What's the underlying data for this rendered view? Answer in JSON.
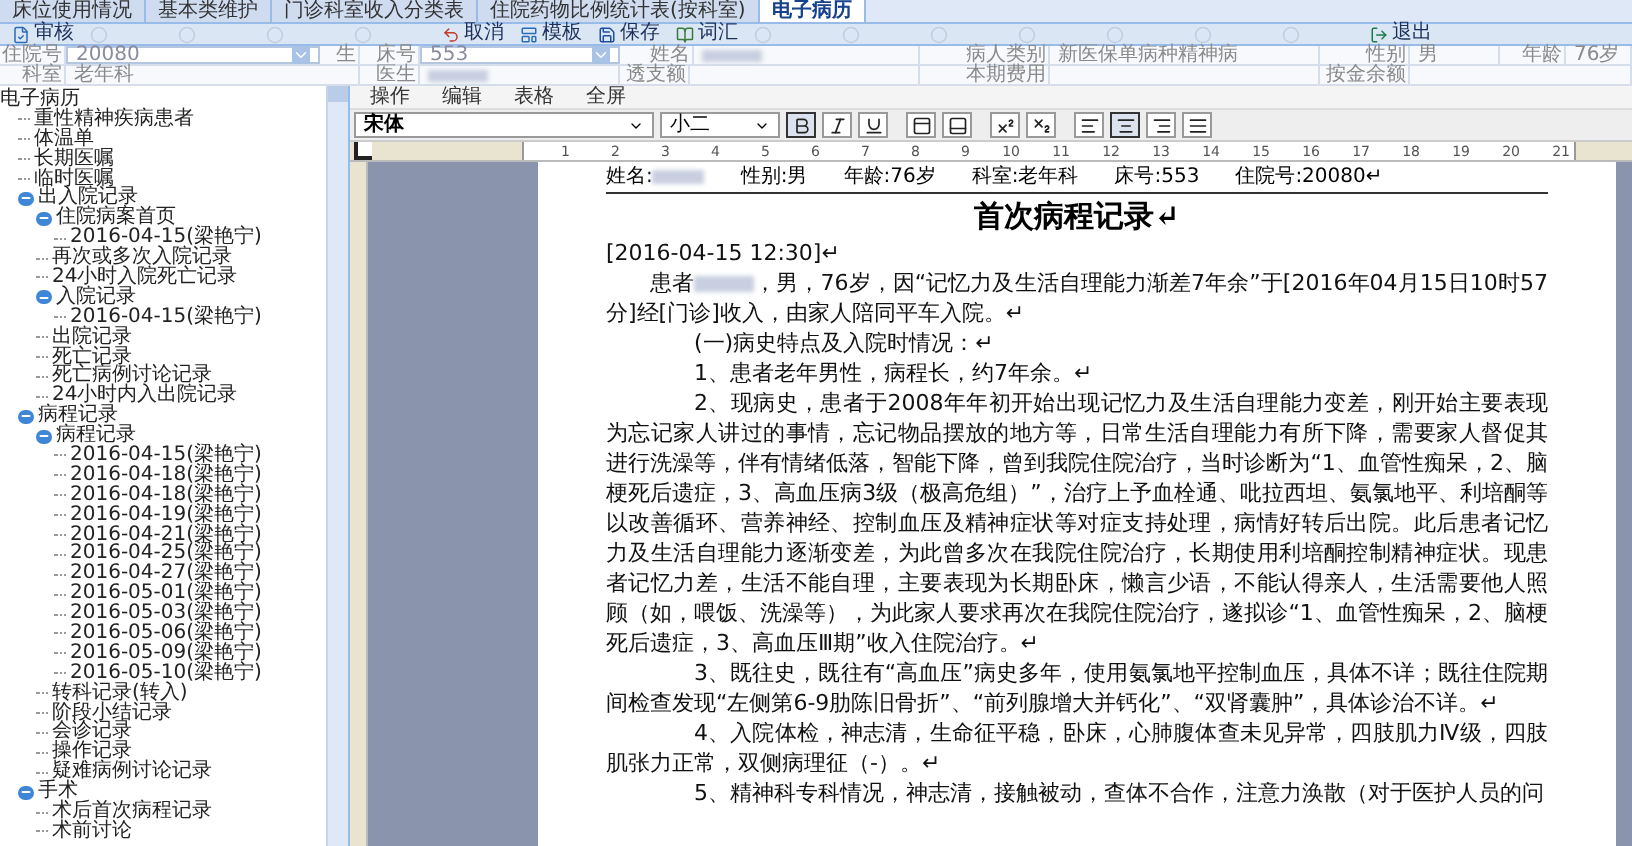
{
  "tabs": [
    {
      "label": "床位使用情况",
      "selected": false
    },
    {
      "label": "基本类维护",
      "selected": false
    },
    {
      "label": "门诊科室收入分类表",
      "selected": false
    },
    {
      "label": "住院药物比例统计表(按科室)",
      "selected": false
    },
    {
      "label": "电子病历",
      "selected": true
    }
  ],
  "toolbar": [
    {
      "kind": "audit",
      "label": "审核",
      "disabled": false
    },
    {
      "kind": "generic",
      "disabled": true
    },
    {
      "kind": "generic",
      "disabled": true
    },
    {
      "kind": "generic",
      "disabled": true
    },
    {
      "kind": "generic",
      "disabled": true
    },
    {
      "kind": "cancel",
      "label": "取消",
      "disabled": false
    },
    {
      "kind": "template",
      "label": "模板",
      "disabled": false
    },
    {
      "kind": "save",
      "label": "保存",
      "disabled": false
    },
    {
      "kind": "vocabulary",
      "label": "词汇",
      "disabled": false
    },
    {
      "kind": "generic",
      "disabled": true
    },
    {
      "kind": "generic",
      "disabled": true
    },
    {
      "kind": "generic",
      "disabled": true
    },
    {
      "kind": "generic",
      "disabled": true
    },
    {
      "kind": "generic",
      "disabled": true
    },
    {
      "kind": "generic",
      "disabled": true
    },
    {
      "kind": "generic",
      "disabled": true
    },
    {
      "kind": "exit",
      "label": "退出",
      "disabled": false
    }
  ],
  "patient_rows": [
    [
      {
        "kind": "label",
        "text": "住院号"
      },
      {
        "kind": "field",
        "text": "20080"
      },
      {
        "kind": "label",
        "text": "生"
      },
      {
        "kind": "label",
        "text": "床号"
      },
      {
        "kind": "field",
        "text": "553"
      },
      {
        "kind": "label",
        "text": "姓名"
      },
      {
        "kind": "redacted"
      },
      {
        "kind": "label",
        "text": "病人类别"
      },
      {
        "kind": "value",
        "text": "新医保单病种精神病"
      },
      {
        "kind": "label",
        "text": "性别"
      },
      {
        "kind": "value",
        "text": "男"
      },
      {
        "kind": "label",
        "text": "年龄"
      },
      {
        "kind": "value",
        "text": "76岁"
      }
    ],
    [
      {
        "kind": "label",
        "text": "科室"
      },
      {
        "kind": "value",
        "text": "老年科"
      },
      {
        "kind": "label",
        "text": "医生"
      },
      {
        "kind": "redacted"
      },
      {
        "kind": "label",
        "text": "透支额"
      },
      {
        "kind": "empty"
      },
      {
        "kind": "label",
        "text": "本期费用"
      },
      {
        "kind": "empty"
      },
      {
        "kind": "label",
        "text": "按金余额"
      },
      {
        "kind": "empty"
      }
    ]
  ],
  "tree": [
    {
      "label": "电子病历",
      "expanded": true,
      "children": [
        {
          "label": "重性精神疾病患者"
        },
        {
          "label": "体温单"
        },
        {
          "label": "长期医嘱"
        },
        {
          "label": "临时医嘱"
        },
        {
          "label": "出入院记录",
          "expanded": true,
          "children": [
            {
              "label": "住院病案首页",
              "expanded": true,
              "children": [
                {
                  "label": "2016-04-15(梁艳宁)"
                }
              ]
            },
            {
              "label": "再次或多次入院记录"
            },
            {
              "label": "24小时入院死亡记录"
            },
            {
              "label": "入院记录",
              "expanded": true,
              "children": [
                {
                  "label": "2016-04-15(梁艳宁)"
                }
              ]
            },
            {
              "label": "出院记录"
            },
            {
              "label": "死亡记录"
            },
            {
              "label": "死亡病例讨论记录"
            },
            {
              "label": "24小时内入出院记录"
            }
          ]
        },
        {
          "label": "病程记录",
          "expanded": true,
          "children": [
            {
              "label": "病程记录",
              "expanded": true,
              "children": [
                {
                  "label": "2016-04-15(梁艳宁)"
                },
                {
                  "label": "2016-04-18(梁艳宁)"
                },
                {
                  "label": "2016-04-18(梁艳宁)"
                },
                {
                  "label": "2016-04-19(梁艳宁)"
                },
                {
                  "label": "2016-04-21(梁艳宁)"
                },
                {
                  "label": "2016-04-25(梁艳宁)"
                },
                {
                  "label": "2016-04-27(梁艳宁)"
                },
                {
                  "label": "2016-05-01(梁艳宁)"
                },
                {
                  "label": "2016-05-03(梁艳宁)"
                },
                {
                  "label": "2016-05-06(梁艳宁)"
                },
                {
                  "label": "2016-05-09(梁艳宁)"
                },
                {
                  "label": "2016-05-10(梁艳宁)"
                }
              ]
            },
            {
              "label": "转科记录(转入)"
            },
            {
              "label": "阶段小结记录"
            },
            {
              "label": "会诊记录"
            },
            {
              "label": "操作记录"
            },
            {
              "label": "疑难病例讨论记录"
            }
          ]
        },
        {
          "label": "手术",
          "expanded": true,
          "children": [
            {
              "label": "术后首次病程记录"
            },
            {
              "label": "术前讨论"
            }
          ]
        }
      ]
    }
  ],
  "editor_menu": [
    "操作",
    "编辑",
    "表格",
    "全屏"
  ],
  "font_select": "宋体",
  "size_select": "小二",
  "format_buttons": [
    {
      "kind": "bold",
      "selected": true
    },
    {
      "kind": "italic",
      "selected": false
    },
    {
      "kind": "underline",
      "selected": false
    },
    {
      "kind": "border-top",
      "selected": false
    },
    {
      "kind": "border-bottom",
      "selected": false
    },
    {
      "kind": "superscript",
      "selected": false
    },
    {
      "kind": "subscript",
      "selected": false
    },
    {
      "kind": "align-left",
      "selected": false
    },
    {
      "kind": "align-center",
      "selected": true
    },
    {
      "kind": "align-right",
      "selected": false
    },
    {
      "kind": "align-justify",
      "selected": false
    }
  ],
  "ruler_numbers": [
    "1",
    "2",
    "3",
    "4",
    "5",
    "6",
    "7",
    "8",
    "9",
    "10",
    "11",
    "12",
    "13",
    "14",
    "15",
    "16",
    "17",
    "18",
    "19",
    "20",
    "21"
  ],
  "document": {
    "header": [
      {
        "label": "姓名:",
        "redacted": true
      },
      {
        "label": "性别:男"
      },
      {
        "label": "年龄:76岁"
      },
      {
        "label": "科室:老年科"
      },
      {
        "label": "床号:553"
      },
      {
        "label": "住院号:20080↵"
      }
    ],
    "title": "首次病程记录↵",
    "paragraphs": [
      {
        "kind": "date",
        "text": "[2016-04-15 12:30]↵"
      },
      {
        "kind": "intro",
        "before": "患者",
        "redacted": true,
        "text": "，男，76岁，因“记忆力及生活自理能力渐差7年余”于[2016年04月15日10时57分]经[门诊]收入，由家人陪同平车入院。↵"
      },
      {
        "kind": "item",
        "text": "(一)病史特点及入院时情况：↵"
      },
      {
        "kind": "item",
        "text": "1、患者老年男性，病程长，约7年余。↵"
      },
      {
        "kind": "item",
        "text": "2、现病史，患者于2008年年初开始出现记忆力及生活自理能力变差，刚开始主要表现为忘记家人讲过的事情，忘记物品摆放的地方等，日常生活自理能力有所下降，需要家人督促其进行洗澡等，伴有情绪低落，智能下降，曾到我院住院治疗，当时诊断为“1、血管性痴呆，2、脑梗死后遗症，3、高血压病3级（极高危组）”，治疗上予血栓通、吡拉西坦、氨氯地平、利培酮等以改善循环、营养神经、控制血压及精神症状等对症支持处理，病情好转后出院。此后患者记忆力及生活自理能力逐渐变差，为此曾多次在我院住院治疗，长期使用利培酮控制精神症状。现患者记忆力差，生活不能自理，主要表现为长期卧床，懒言少语，不能认得亲人，生活需要他人照顾（如，喂饭、洗澡等），为此家人要求再次在我院住院治疗，遂拟诊“1、血管性痴呆，2、脑梗死后遗症，3、高血压Ⅲ期”收入住院治疗。↵"
      },
      {
        "kind": "item",
        "text": "3、既往史，既往有“高血压”病史多年，使用氨氯地平控制血压，具体不详；既往住院期间检查发现“左侧第6-9肋陈旧骨折”、“前列腺增大并钙化”、“双肾囊肿”，具体诊治不详。↵"
      },
      {
        "kind": "item",
        "text": "4、入院体检，神志清，生命征平稳，卧床，心肺腹体查未见异常，四肢肌力Ⅳ级，四肢肌张力正常，双侧病理征（-）。↵"
      },
      {
        "kind": "item",
        "text": "5、精神科专科情况，神志清，接触被动，查体不合作，注意力涣散（对于医护人员的问"
      }
    ]
  }
}
